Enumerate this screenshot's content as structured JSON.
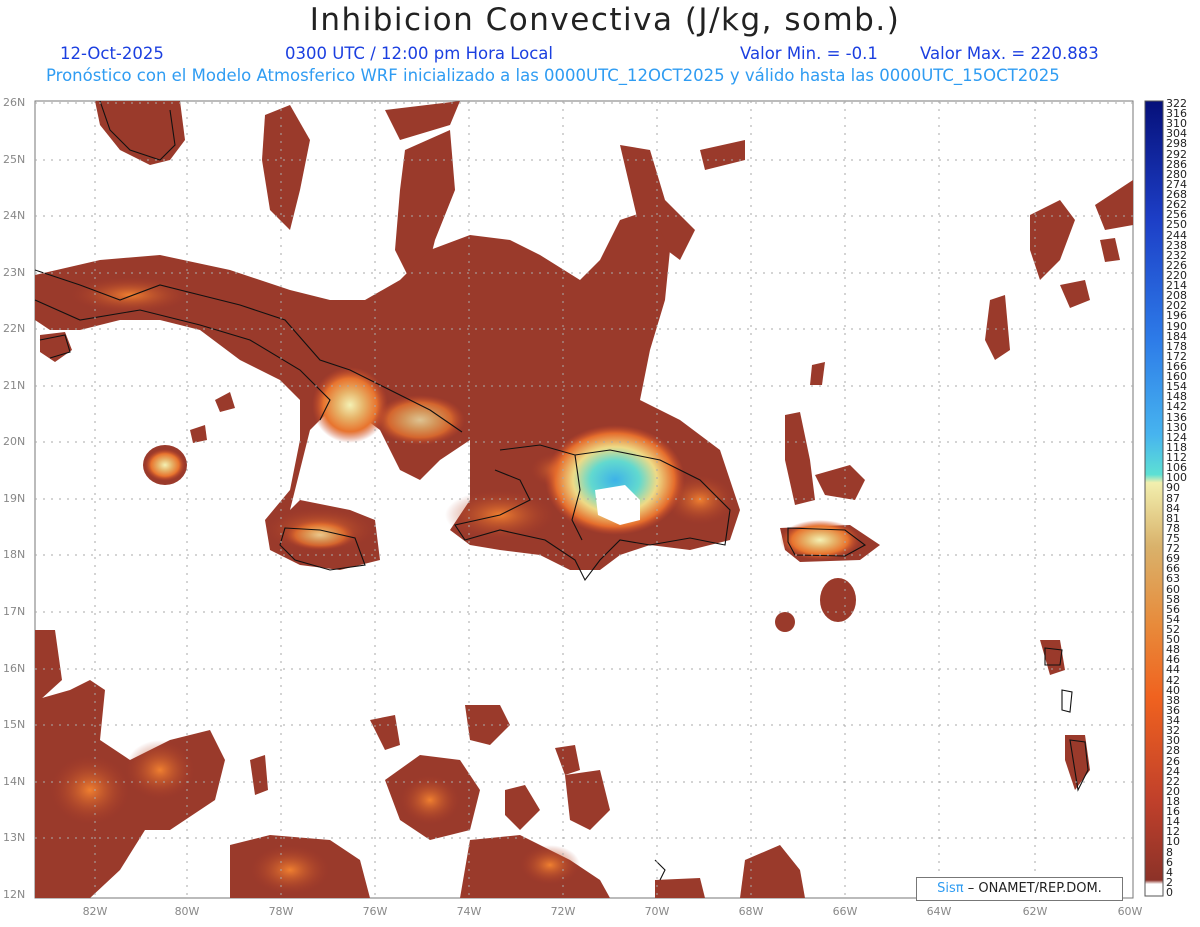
{
  "header": {
    "title": "Inhibicion Convectiva (J/kg, somb.)",
    "date": "12-Oct-2025",
    "time": "0300 UTC / 12:00 pm Hora Local",
    "valor_min": "Valor Min. = -0.1",
    "valor_max": "Valor Max. = 220.883",
    "run_info": "Pronóstico con el Modelo Atmosferico WRF inicializado a las 0000UTC_12OCT2025 y válido hasta las  0000UTC_15OCT2025"
  },
  "map": {
    "lat_labels": [
      "26N",
      "25N",
      "24N",
      "23N",
      "22N",
      "21N",
      "20N",
      "19N",
      "18N",
      "17N",
      "16N",
      "15N",
      "14N",
      "13N",
      "12N"
    ],
    "lon_labels": [
      "82W",
      "80W",
      "78W",
      "76W",
      "74W",
      "72W",
      "70W",
      "68W",
      "66W",
      "64W",
      "62W",
      "60W"
    ],
    "credit_sis": "Sisπ",
    "credit_text": "– ONAMET/REP.DOM."
  },
  "legend": {
    "labels": [
      "322",
      "316",
      "310",
      "304",
      "298",
      "292",
      "286",
      "280",
      "274",
      "268",
      "262",
      "256",
      "250",
      "244",
      "238",
      "232",
      "226",
      "220",
      "214",
      "208",
      "202",
      "196",
      "190",
      "184",
      "178",
      "172",
      "166",
      "160",
      "154",
      "148",
      "142",
      "136",
      "130",
      "124",
      "118",
      "112",
      "106",
      "100",
      "90",
      "87",
      "84",
      "81",
      "78",
      "75",
      "72",
      "69",
      "66",
      "63",
      "60",
      "58",
      "56",
      "54",
      "52",
      "50",
      "48",
      "46",
      "44",
      "42",
      "40",
      "38",
      "36",
      "34",
      "32",
      "30",
      "28",
      "26",
      "24",
      "22",
      "20",
      "18",
      "16",
      "14",
      "12",
      "10",
      "8",
      "6",
      "4",
      "2",
      "0"
    ],
    "colors": {
      "deep_blue": "#06107a",
      "blue": "#2d6be0",
      "light_blue": "#47b4ef",
      "cyan": "#5de0d4",
      "pale_yellow": "#f2efae",
      "tan": "#d4b06a",
      "orange": "#f07a2c",
      "red_orange": "#d9502a",
      "brown": "#8c3228"
    }
  }
}
